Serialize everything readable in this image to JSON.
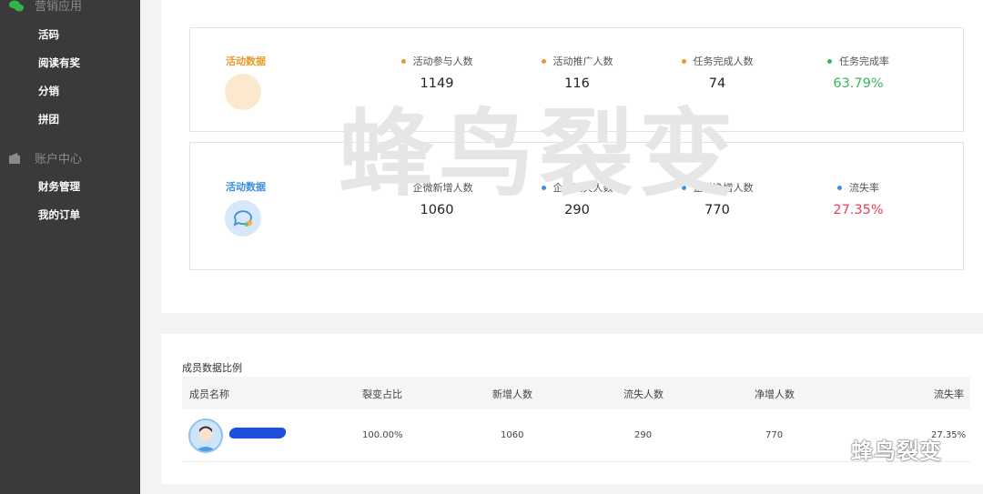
{
  "sidebar": {
    "group1": {
      "label": "营销应用",
      "icon": "wechat-icon"
    },
    "group1_items": [
      {
        "label": "活码"
      },
      {
        "label": "阅读有奖"
      },
      {
        "label": "分销"
      },
      {
        "label": "拼团"
      }
    ],
    "group2": {
      "label": "账户中心",
      "icon": "wallet-icon"
    },
    "group2_items": [
      {
        "label": "财务管理"
      },
      {
        "label": "我的订单"
      }
    ]
  },
  "card1": {
    "label": "活动数据",
    "label_color": "#e49b2b",
    "metrics": [
      {
        "label": "活动参与人数",
        "value": "1149",
        "dot_color": "#e49b2b"
      },
      {
        "label": "活动推广人数",
        "value": "116",
        "dot_color": "#e49b2b"
      },
      {
        "label": "任务完成人数",
        "value": "74",
        "dot_color": "#e49b2b"
      },
      {
        "label": "任务完成率",
        "value": "63.79%",
        "dot_color": "#3cb45e",
        "value_color": "#3cb45e"
      }
    ]
  },
  "card2": {
    "label": "活动数据",
    "label_color": "#3d8ee0",
    "metrics": [
      {
        "label": "企微新增人数",
        "value": "1060",
        "dot_color": "#3d8ee0"
      },
      {
        "label": "企微流失人数",
        "value": "290",
        "dot_color": "#3d8ee0"
      },
      {
        "label": "企微净增人数",
        "value": "770",
        "dot_color": "#3d8ee0"
      },
      {
        "label": "流失率",
        "value": "27.35%",
        "dot_color": "#3d8ee0",
        "value_color": "#e6415a"
      }
    ]
  },
  "watermark": "蜂鸟裂变",
  "table": {
    "title": "成员数据比例",
    "columns": [
      "成员名称",
      "裂变占比",
      "新增人数",
      "流失人数",
      "净增人数",
      "流失率"
    ],
    "rows": [
      {
        "share": "100.00%",
        "new": "1060",
        "lost": "290",
        "net": "770",
        "rate": "27.35%"
      }
    ]
  },
  "brand": "蜂鸟裂变"
}
